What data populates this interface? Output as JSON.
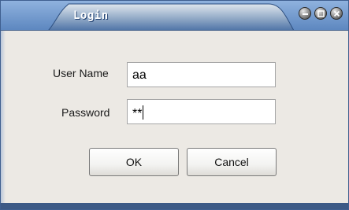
{
  "window": {
    "title": "Login",
    "controls": [
      "minimize-icon",
      "maximize-icon",
      "close-icon"
    ],
    "colors": {
      "titlebar": "#6f99d0",
      "tab": "#ece9e4",
      "frame": "#3d5a86"
    }
  },
  "form": {
    "username_label": "User Name",
    "username_value": "aa",
    "password_label": "Password",
    "password_value": "**",
    "ok_label": "OK",
    "cancel_label": "Cancel"
  }
}
